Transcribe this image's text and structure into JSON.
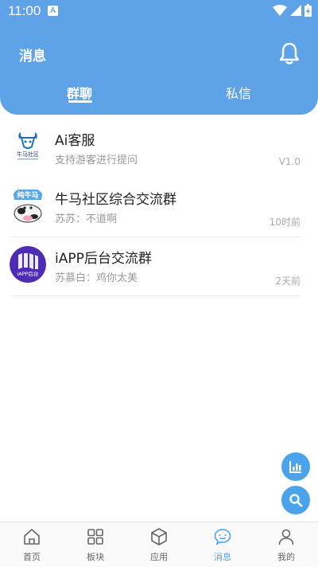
{
  "status_bar": {
    "time": "11:00",
    "notification_letter": "A"
  },
  "header": {
    "title": "消息"
  },
  "tabs": [
    {
      "label": "群聊",
      "active": true
    },
    {
      "label": "私信",
      "active": false
    }
  ],
  "chats": [
    {
      "name": "Ai客服",
      "preview": "支持游客进行提问",
      "meta": "V1.0",
      "avatar_icon": "niuma-community-logo",
      "avatar_text": "牛马社区"
    },
    {
      "name": "牛马社区综合交流群",
      "preview": "苏苏：不道啊",
      "meta": "10时前",
      "avatar_icon": "cow-mascot-logo",
      "avatar_text": "纯牛马"
    },
    {
      "name": "iAPP后台交流群",
      "preview": "苏慕白：鸡你太美",
      "meta": "2天前",
      "avatar_icon": "iapp-backend-logo",
      "avatar_text": "iAPP后台"
    }
  ],
  "bottom_nav": [
    {
      "label": "首页",
      "icon": "home-icon",
      "active": false
    },
    {
      "label": "板块",
      "icon": "grid-icon",
      "active": false
    },
    {
      "label": "应用",
      "icon": "cube-icon",
      "active": false
    },
    {
      "label": "消息",
      "icon": "chat-bubble-icon",
      "active": true
    },
    {
      "label": "我的",
      "icon": "profile-icon",
      "active": false
    }
  ],
  "colors": {
    "primary": "#5ea3e8",
    "accent": "#4ba3ec",
    "muted": "#999999"
  }
}
